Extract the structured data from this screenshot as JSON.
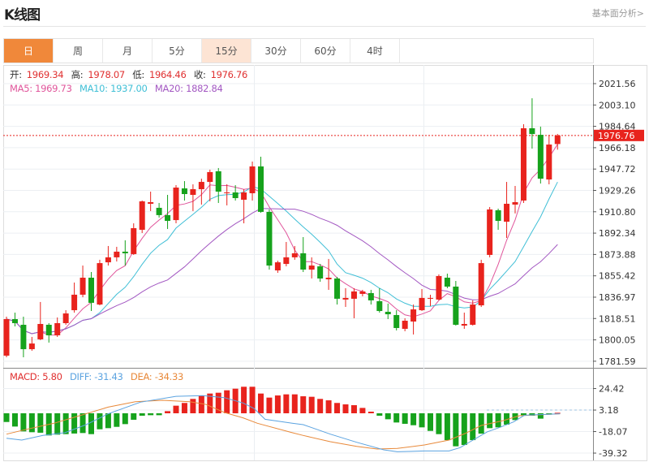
{
  "header": {
    "title": "K线图",
    "fundamental_link": "基本面分析>"
  },
  "tabs": [
    {
      "label": "日",
      "state": "active"
    },
    {
      "label": "周"
    },
    {
      "label": "月"
    },
    {
      "label": "5分"
    },
    {
      "label": "15分",
      "state": "hover"
    },
    {
      "label": "30分"
    },
    {
      "label": "60分"
    },
    {
      "label": "4时"
    }
  ],
  "ohlc_legend": {
    "open_label": "开:",
    "open": "1969.34",
    "high_label": "高:",
    "high": "1978.07",
    "low_label": "低:",
    "low": "1964.46",
    "close_label": "收:",
    "close": "1976.76"
  },
  "ma_legend": {
    "ma5": "MA5: 1969.73",
    "ma10": "MA10: 1937.00",
    "ma20": "MA20: 1882.84"
  },
  "macd_legend": {
    "macd": "MACD: 5.80",
    "diff": "DIFF: -31.43",
    "dea": "DEA: -34.33"
  },
  "colors": {
    "up": "#e8231d",
    "down": "#16a21c",
    "accent": "#f0883a",
    "ma5": "#e0559b",
    "ma10": "#40bfd6",
    "ma20": "#a358c2",
    "diff": "#5ba3e0",
    "dea": "#e8893a"
  },
  "chart_data": [
    {
      "type": "candlestick",
      "y_ticks": [
        "2021.56",
        "2003.10",
        "1984.64",
        "1966.18",
        "1947.72",
        "1929.26",
        "1910.80",
        "1892.34",
        "1873.88",
        "1855.42",
        "1836.97",
        "1818.51",
        "1800.05",
        "1781.59"
      ],
      "ylim": [
        1781.59,
        2021.56
      ],
      "current_price": "1976.76",
      "grid": true,
      "candles_ohlc": [
        [
          1786.4,
          1820.1,
          1785.0,
          1818.0
        ],
        [
          1818.0,
          1823.6,
          1811.7,
          1814.5
        ],
        [
          1813.1,
          1820.1,
          1785.0,
          1792.0
        ],
        [
          1792.0,
          1802.6,
          1790.6,
          1796.9
        ],
        [
          1800.5,
          1832.8,
          1799.8,
          1813.8
        ],
        [
          1813.1,
          1814.5,
          1797.7,
          1804.0
        ],
        [
          1804.0,
          1819.4,
          1802.6,
          1814.5
        ],
        [
          1814.5,
          1825.7,
          1813.1,
          1822.9
        ],
        [
          1825.7,
          1849.6,
          1823.6,
          1839.1
        ],
        [
          1839.1,
          1864.3,
          1836.9,
          1853.8
        ],
        [
          1853.8,
          1858.7,
          1825.0,
          1832.1
        ],
        [
          1830.6,
          1869.3,
          1829.9,
          1866.4
        ],
        [
          1867.1,
          1881.2,
          1864.3,
          1871.4
        ],
        [
          1871.4,
          1880.5,
          1867.8,
          1876.3
        ],
        [
          1876.3,
          1886.1,
          1864.3,
          1874.9
        ],
        [
          1874.2,
          1900.8,
          1873.5,
          1896.6
        ],
        [
          1895.2,
          1920.5,
          1892.4,
          1919.8
        ],
        [
          1917.7,
          1928.2,
          1911.4,
          1919.1
        ],
        [
          1914.2,
          1918.4,
          1905.8,
          1907.9
        ],
        [
          1907.9,
          1925.4,
          1895.9,
          1902.9
        ],
        [
          1903.6,
          1933.8,
          1900.8,
          1931.7
        ],
        [
          1931.0,
          1937.3,
          1920.5,
          1926.1
        ],
        [
          1925.4,
          1934.5,
          1911.4,
          1930.3
        ],
        [
          1930.3,
          1939.4,
          1917.0,
          1936.6
        ],
        [
          1936.6,
          1947.2,
          1919.8,
          1945.1
        ],
        [
          1945.8,
          1948.6,
          1918.4,
          1928.2
        ],
        [
          1926.8,
          1934.5,
          1916.3,
          1927.5
        ],
        [
          1927.5,
          1933.8,
          1920.5,
          1922.6
        ],
        [
          1921.2,
          1930.3,
          1900.8,
          1927.5
        ],
        [
          1926.8,
          1954.2,
          1920.5,
          1950.0
        ],
        [
          1950.0,
          1958.4,
          1910.0,
          1910.7
        ],
        [
          1910.7,
          1912.8,
          1860.8,
          1864.3
        ],
        [
          1860.1,
          1868.5,
          1858.0,
          1867.1
        ],
        [
          1865.7,
          1884.7,
          1863.6,
          1871.4
        ],
        [
          1871.4,
          1881.2,
          1869.3,
          1874.9
        ],
        [
          1874.9,
          1888.9,
          1858.7,
          1860.8
        ],
        [
          1860.8,
          1871.4,
          1853.1,
          1864.3
        ],
        [
          1863.6,
          1865.7,
          1850.3,
          1853.1
        ],
        [
          1852.4,
          1870.0,
          1843.3,
          1853.8
        ],
        [
          1853.1,
          1854.5,
          1830.6,
          1835.6
        ],
        [
          1834.9,
          1844.7,
          1828.5,
          1836.3
        ],
        [
          1835.6,
          1844.7,
          1818.7,
          1841.9
        ],
        [
          1839.8,
          1843.3,
          1837.7,
          1841.9
        ],
        [
          1840.5,
          1843.3,
          1830.6,
          1834.2
        ],
        [
          1833.5,
          1844.7,
          1823.6,
          1825.0
        ],
        [
          1824.3,
          1831.4,
          1818.0,
          1822.2
        ],
        [
          1821.5,
          1825.7,
          1808.2,
          1810.3
        ],
        [
          1809.6,
          1818.7,
          1807.5,
          1816.6
        ],
        [
          1815.9,
          1830.6,
          1804.7,
          1826.4
        ],
        [
          1825.7,
          1844.0,
          1825.0,
          1836.3
        ],
        [
          1835.6,
          1839.1,
          1829.2,
          1836.3
        ],
        [
          1834.9,
          1856.6,
          1834.2,
          1855.2
        ],
        [
          1853.8,
          1857.3,
          1844.7,
          1846.1
        ],
        [
          1846.1,
          1851.0,
          1812.4,
          1813.1
        ],
        [
          1812.4,
          1823.6,
          1809.6,
          1813.8
        ],
        [
          1813.1,
          1834.2,
          1812.4,
          1830.6
        ],
        [
          1829.9,
          1869.3,
          1828.5,
          1866.4
        ],
        [
          1873.5,
          1914.9,
          1871.4,
          1912.8
        ],
        [
          1912.1,
          1913.5,
          1895.2,
          1902.9
        ],
        [
          1902.2,
          1936.6,
          1888.2,
          1917.7
        ],
        [
          1917.0,
          1933.1,
          1909.3,
          1919.1
        ],
        [
          1920.5,
          1986.5,
          1918.4,
          1983.0
        ],
        [
          1983.0,
          2008.9,
          1965.4,
          1978.0
        ],
        [
          1977.3,
          1984.4,
          1935.2,
          1939.4
        ],
        [
          1938.7,
          1977.3,
          1934.5,
          1968.9
        ],
        [
          1969.34,
          1978.07,
          1964.46,
          1976.76
        ]
      ],
      "moving_averages": [
        5,
        10,
        20
      ]
    },
    {
      "type": "bar+line",
      "y_ticks": [
        "24.42",
        "3.18",
        "-18.07",
        "-39.32"
      ],
      "macd_hist": [
        -8.6,
        -13.1,
        -17.9,
        -18.7,
        -19.2,
        -21.9,
        -21.1,
        -20.6,
        -20.0,
        -19.5,
        -20.6,
        -15.8,
        -14.7,
        -13.4,
        -10.7,
        -6.4,
        -2.4,
        -1.9,
        -1.9,
        2.1,
        7.5,
        10.2,
        14.2,
        17.4,
        19.5,
        20.3,
        22.7,
        24.3,
        26.2,
        26.2,
        19.5,
        15.5,
        17.6,
        18.7,
        18.7,
        16.8,
        16.3,
        14.2,
        12.8,
        10.2,
        8.8,
        8.0,
        5.3,
        1.6,
        -2.4,
        -5.9,
        -9.1,
        -10.4,
        -11.8,
        -13.9,
        -17.4,
        -20.6,
        -26.5,
        -32.6,
        -31.3,
        -26.5,
        -20.1,
        -14.7,
        -13.9,
        -11.2,
        -6.7,
        -1.9,
        -2.4,
        -5.3,
        -1.3,
        0.5
      ],
      "diff": [
        [
          1,
          -24.6
        ],
        [
          2.8,
          -26.5
        ],
        [
          5.3,
          -21.9
        ],
        [
          7.9,
          -19.2
        ],
        [
          10.4,
          -11.2
        ],
        [
          13,
          -0.5
        ],
        [
          16.8,
          11.0
        ],
        [
          21,
          16.8
        ],
        [
          24.2,
          17.4
        ],
        [
          26.7,
          15.5
        ],
        [
          28.9,
          10.2
        ],
        [
          30.2,
          4.8
        ],
        [
          31.5,
          -5.9
        ],
        [
          34.7,
          -9.9
        ],
        [
          36,
          -11.2
        ],
        [
          39.2,
          -20.6
        ],
        [
          42.3,
          -28.6
        ],
        [
          45.5,
          -36.1
        ],
        [
          47.1,
          -38.0
        ],
        [
          50.3,
          -37.2
        ],
        [
          53.2,
          -37.2
        ],
        [
          54.5,
          -33.9
        ],
        [
          55.7,
          -28.1
        ],
        [
          57.7,
          -18.4
        ],
        [
          59.2,
          -13.9
        ],
        [
          60.8,
          -8.6
        ],
        [
          62.1,
          -1.9
        ],
        [
          66.3,
          -0.5
        ]
      ],
      "dea": [
        [
          1,
          -20.6
        ],
        [
          3.4,
          -15.8
        ],
        [
          6.6,
          -9.9
        ],
        [
          9.8,
          -1.9
        ],
        [
          13,
          6.1
        ],
        [
          16.2,
          11.5
        ],
        [
          19.4,
          12.8
        ],
        [
          22.6,
          11.5
        ],
        [
          24.5,
          8.8
        ],
        [
          26.7,
          0.8
        ],
        [
          28.9,
          -4.5
        ],
        [
          30.6,
          -9.9
        ],
        [
          34.7,
          -19.2
        ],
        [
          36,
          -21.9
        ],
        [
          39.2,
          -28.1
        ],
        [
          42.3,
          -32.6
        ],
        [
          44.7,
          -35.3
        ],
        [
          47.1,
          -34.7
        ],
        [
          50.3,
          -31.3
        ],
        [
          53.2,
          -26.5
        ],
        [
          55.1,
          -20.0
        ],
        [
          57,
          -12.0
        ],
        [
          59.6,
          -7.2
        ],
        [
          61.5,
          -2.4
        ],
        [
          66.3,
          -0.5
        ]
      ]
    }
  ]
}
